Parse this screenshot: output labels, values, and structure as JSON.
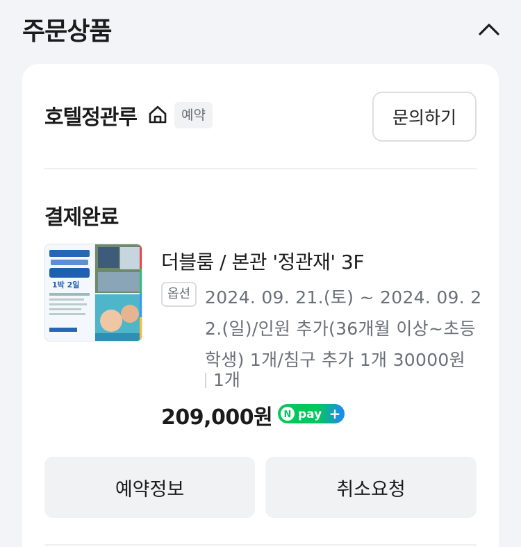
{
  "section": {
    "title": "주문상품",
    "collapse_icon": "chevron-up-icon"
  },
  "store": {
    "name": "호텔정관루",
    "icon": "home-icon",
    "badge": "예약",
    "inquiry_button": "문의하기"
  },
  "order": {
    "status": "결제완료",
    "product_name": "더블룸 / 본관 '정관재' 3F",
    "option_badge": "옵션",
    "option_lines": [
      "2024. 09. 21.(토) ~ 2024. 09. 2",
      "2.(일)/인원 추가(36개월 이상~초등",
      "학생) 1개/침구 추가 1개 30000원"
    ],
    "quantity": "1개",
    "price": "209,000원",
    "pay_badge": "N pay+",
    "pay_badge_parts": [
      "N",
      "pay",
      "+"
    ],
    "thumbnail_text": [
      "1박 2일"
    ]
  },
  "actions": {
    "reservation_info": "예약정보",
    "cancel_request": "취소요청"
  },
  "colors": {
    "page_bg": "#f3f4f7",
    "card_bg": "#ffffff",
    "button_bg": "#f1f2f4",
    "npay_green": "#03c75a",
    "npay_blue": "#1e86ff"
  }
}
